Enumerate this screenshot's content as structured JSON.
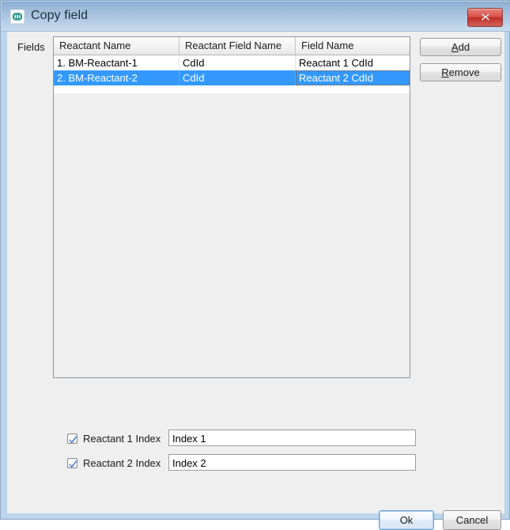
{
  "window": {
    "title": "Copy field",
    "icon": "molecule-icon",
    "close_label": "×",
    "frame_color": "#bcd4ec",
    "titlebar_gradient_top": "#7fa5cd",
    "titlebar_gradient_bottom": "#cddff0"
  },
  "form": {
    "fields_label": "Fields"
  },
  "table": {
    "columns": [
      "Reactant Name",
      "Reactant Field Name",
      "Field Name"
    ],
    "rows": [
      {
        "cells": [
          "1. BM-Reactant-1",
          "CdId",
          "Reactant 1 CdId"
        ],
        "selected": false
      },
      {
        "cells": [
          "2. BM-Reactant-2",
          "CdId",
          "Reactant 2 CdId"
        ],
        "selected": true
      }
    ],
    "selection_color": "#3399ff"
  },
  "side_buttons": {
    "add": {
      "mnemonic": "A",
      "rest": "dd"
    },
    "remove": {
      "mnemonic": "R",
      "rest": "emove"
    }
  },
  "index_options": [
    {
      "checked": true,
      "label": "Reactant 1 Index",
      "value": "Index 1",
      "placeholder": ""
    },
    {
      "checked": true,
      "label": "Reactant 2 Index",
      "value": "Index 2",
      "placeholder": ""
    }
  ],
  "footer": {
    "ok_label": "Ok",
    "cancel_label": "Cancel",
    "default_button": "Ok"
  }
}
